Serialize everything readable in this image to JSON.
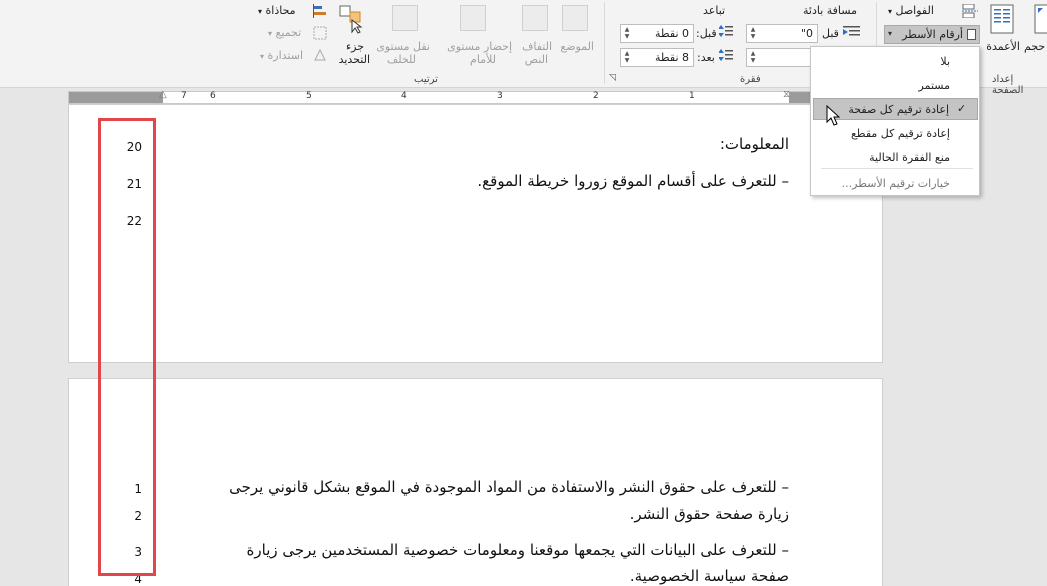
{
  "ribbon": {
    "arrange": {
      "group_label": "ترتيب",
      "align": "محاذاة",
      "group": "تجميع",
      "rotate": "استدارة",
      "selection_pane_1": "جزء",
      "selection_pane_2": "التحديد",
      "send_backward_1": "نقل مستوى",
      "send_backward_2": "للخلف",
      "bring_forward_1": "إحضار مستوى",
      "bring_forward_2": "للأمام",
      "wrap_text_1": "التفاف",
      "wrap_text_2": "النص",
      "position": "الموضع"
    },
    "paragraph": {
      "group_label": "فقرة",
      "indent_label": "مسافة بادئة",
      "spacing_label": "تباعد",
      "before_label": "قبل",
      "before_value": "0\"",
      "spacing_before_label": "قبل:",
      "spacing_before_value": "0 نقطة",
      "spacing_after_label": "بعد:",
      "spacing_after_value": "8 نقطة"
    },
    "page_setup": {
      "group_label": "إعداد الصفحة",
      "breaks": "الفواصل",
      "line_numbers": "أرقام الأسطر",
      "columns": "الأعمدة",
      "size": "حجم"
    }
  },
  "ruler": {
    "numbers": [
      "7",
      "6",
      "5",
      "4",
      "3",
      "2",
      "1"
    ]
  },
  "menu": {
    "items": [
      {
        "label": "بلا",
        "state": "normal"
      },
      {
        "label": "مستمر",
        "state": "normal"
      },
      {
        "label": "إعادة ترقيم كل صفحة",
        "state": "checked"
      },
      {
        "label": "إعادة ترقيم كل مقطع",
        "state": "normal"
      },
      {
        "label": "منع الفقرة الحالية",
        "state": "normal"
      },
      {
        "label": "خيارات ترقيم الأسطر...",
        "state": "normal"
      }
    ]
  },
  "document": {
    "page1": {
      "line_numbers": [
        "20",
        "21",
        "22"
      ],
      "lines": [
        "المعلومات:",
        "– للتعرف على أقسام الموقع زوروا خريطة الموقع."
      ]
    },
    "page2": {
      "line_numbers": [
        "1",
        "2",
        "3",
        "4"
      ],
      "lines": [
        "– للتعرف على حقوق النشر والاستفادة من المواد الموجودة في الموقع بشكل قانوني يرجى",
        "زيارة صفحة حقوق النشر.",
        "– للتعرف على البيانات التي يجمعها موقعنا ومعلومات خصوصية المستخدمين يرجى زيارة",
        "صفحة سياسة الخصوصية."
      ]
    }
  },
  "colors": {
    "highlight_border": "#e0464a",
    "ribbon_bg": "#f3f3f3",
    "menu_hover": "#c4c4c4"
  }
}
